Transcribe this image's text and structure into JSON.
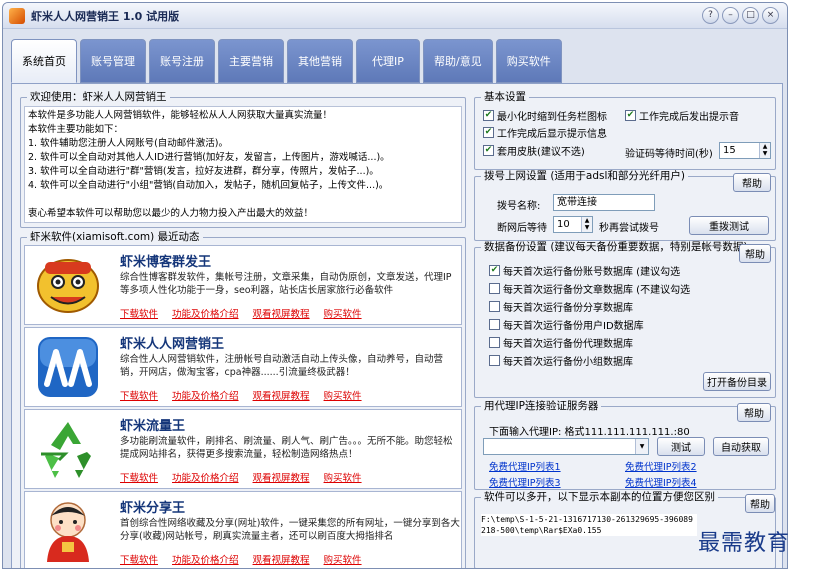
{
  "window": {
    "title": "虾米人人网营销王 1.0 试用版"
  },
  "tabs": [
    "系统首页",
    "账号管理",
    "账号注册",
    "主要营销",
    "其他营销",
    "代理IP",
    "帮助/意见",
    "购买软件"
  ],
  "welcome": {
    "title": "欢迎使用：虾米人人网营销王",
    "lines": [
      "本软件是多功能人人网营销软件，能够轻松从人人网获取大量真实流量！",
      "本软件主要功能如下：",
      "1. 软件辅助您注册人人网账号(自动邮件激活)。",
      "2. 软件可以全自动对其他人人ID进行营销(加好友，发留言，上传图片，游戏喊话...)。",
      "3. 软件可以全自动进行\"群\"营销(发言，拉好友进群，群分享，传照片，发帖子...)。",
      "4. 软件可以全自动进行\"小组\"营销(自动加入，发帖子，随机回复帖子，上传文件...)。",
      "",
      "衷心希望本软件可以帮助您以最少的人力物力投入产出最大的效益！"
    ]
  },
  "news": {
    "title": "虾米软件(xiamisoft.com) 最近动态",
    "products": [
      {
        "name": "虾米博客群发王",
        "desc": "综合性博客群发软件，集帐号注册，文章采集，自动伪原创，文章发送，代理IP等多项人性化功能于一身，seo利器，站长店长居家旅行必备软件",
        "icon": "lion-dance-icon"
      },
      {
        "name": "虾米人人网营销王",
        "desc": "综合性人人网营销软件，注册帐号自动激活自动上传头像，自动养号，自动营销，开网店，做淘宝客，cpa神器......引流量终极武器！",
        "icon": "renren-logo-icon"
      },
      {
        "name": "虾米流量王",
        "desc": "多功能刷流量软件，刷排名、刷流量、刷人气、刷广告。。。无所不能。助您轻松提成网站排名，获得更多搜索流量，轻松制造网络热点！",
        "icon": "recycle-arrows-icon"
      },
      {
        "name": "虾米分享王",
        "desc": "首创综合性网络收藏及分享(网址)软件，一键采集您的所有网址，一键分享到各大分享(收藏)网站帐号，刷真实流量主者，还可以刷百度大拇指排名",
        "icon": "doll-icon"
      }
    ],
    "links": [
      "下载软件",
      "功能及价格介绍",
      "观看视屏教程",
      "购买软件"
    ]
  },
  "basic": {
    "title": "基本设置",
    "opts": [
      "最小化时缩到任务栏图标",
      "工作完成后发出提示音",
      "工作完成后显示提示信息",
      "套用皮肤(建议不选)"
    ],
    "captcha_label": "验证码等待时间(秒)",
    "captcha_value": "15"
  },
  "dial": {
    "title": "拨号上网设置 (适用于adsl和部分光纤用户)",
    "help": "帮助",
    "name_label": "拨号名称:",
    "name_value": "宽带连接",
    "wait_label": "断网后等待",
    "wait_value": "10",
    "retry_label": "秒再尝试拨号",
    "test": "重拨测试"
  },
  "backup": {
    "title": "数据备份设置 (建议每天备份重要数据，特别是帐号数据)",
    "help": "帮助",
    "opts": [
      "每天首次运行备份账号数据库 (建议勾选",
      "每天首次运行备份文章数据库 (不建议勾选",
      "每天首次运行备份分享数据库",
      "每天首次运行备份用户ID数据库",
      "每天首次运行备份代理数据库",
      "每天首次运行备份小组数据库"
    ],
    "open": "打开备份目录"
  },
  "proxy": {
    "title": "用代理IP连接验证服务器",
    "help": "帮助",
    "label": "下面输入代理IP: 格式111.111.111.111.:80",
    "test": "测试",
    "auto": "自动获取",
    "links": [
      "免费代理IP列表1",
      "免费代理IP列表2",
      "免费代理IP列表3",
      "免费代理IP列表4"
    ]
  },
  "path": {
    "title": "软件可以多开，以下显示本副本的位置方便您区别",
    "help": "帮助",
    "value": "F:\\temp\\S-1-5-21-1316717130-261329695-396089218-500\\temp\\Rar$EXa0.155"
  },
  "watermark": "最需教育"
}
